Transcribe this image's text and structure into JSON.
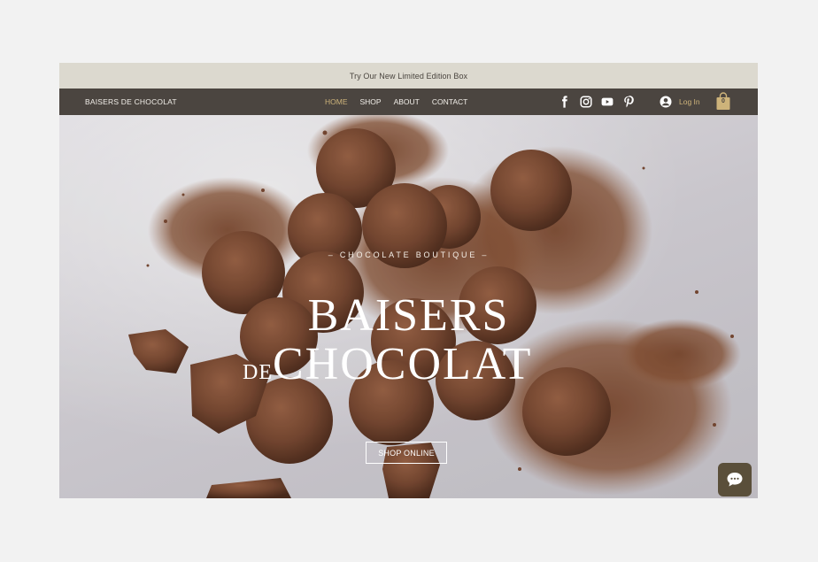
{
  "announcement": {
    "text": "Try Our New Limited Edition Box"
  },
  "header": {
    "brand": "BAISERS DE CHOCOLAT",
    "nav": [
      {
        "label": "HOME",
        "active": true
      },
      {
        "label": "SHOP",
        "active": false
      },
      {
        "label": "ABOUT",
        "active": false
      },
      {
        "label": "CONTACT",
        "active": false
      }
    ],
    "social_icons": [
      "facebook-icon",
      "instagram-icon",
      "youtube-icon",
      "pinterest-icon"
    ],
    "login_label": "Log In",
    "cart_count": "0"
  },
  "hero": {
    "eyebrow": "CHOCOLATE BOUTIQUE",
    "title_line1": "BAISERS",
    "title_line2_prefix": "DE",
    "title_line2_main": "CHOCOLAT",
    "cta_label": "SHOP ONLINE"
  },
  "colors": {
    "announcement_bg": "#dcd9cf",
    "nav_bg": "#4b4540",
    "accent_gold": "#cdb37a",
    "chocolate": "#7a4a33",
    "chat_bg": "#5a4f3a"
  }
}
